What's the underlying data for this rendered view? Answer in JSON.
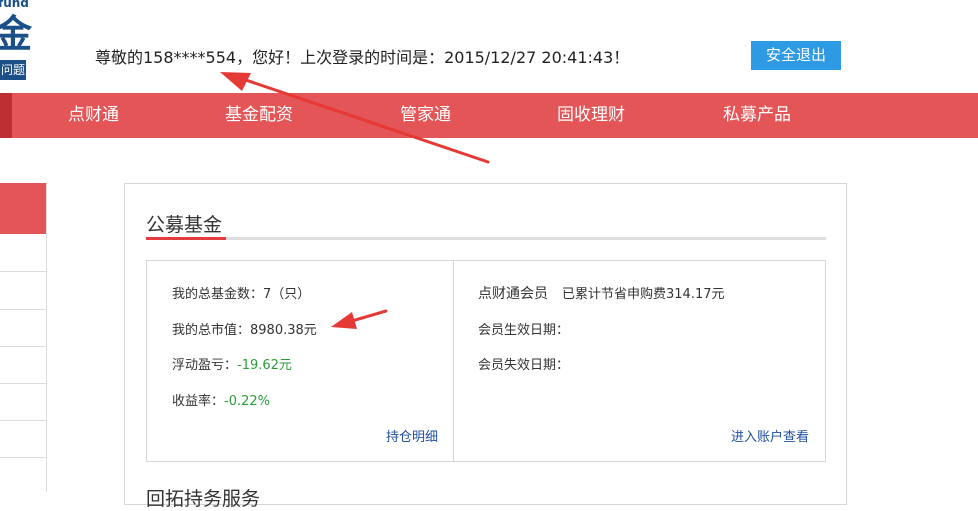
{
  "logo": {
    "fund_text": "fund",
    "glyph": "金",
    "badge_text": "问题"
  },
  "header": {
    "welcome_text": "尊敬的158****554，您好！上次登录的时间是：2015/12/27 20:41:43！",
    "logout_label": "安全退出"
  },
  "nav": {
    "items": [
      "点财通",
      "基金配资",
      "管家通",
      "固收理财",
      "私募产品"
    ]
  },
  "fund_section": {
    "title": "公募基金",
    "left": {
      "total_count_label": "我的总基金数：",
      "total_count_value": "7（只）",
      "market_value_label": "我的总市值：",
      "market_value_value": "8980.38元",
      "float_pl_label": "浮动盈亏：",
      "float_pl_value": "-19.62元",
      "yield_label": "收益率：",
      "yield_value": "-0.22%",
      "holdings_link": "持仓明细"
    },
    "right": {
      "member_label": "点财通会员",
      "saved_text": "已累计节省申购费314.17元",
      "effective_date_label": "会员生效日期：",
      "expire_date_label": "会员失效日期：",
      "account_link": "进入账户查看"
    }
  },
  "next_section_title": "回拓持务服务",
  "colors": {
    "nav_red": "#e45557",
    "accent_blue": "#2f9ae4",
    "link_blue": "#1f4e9c",
    "negative_green": "#2a9d3a",
    "arrow_red": "#e53935"
  }
}
